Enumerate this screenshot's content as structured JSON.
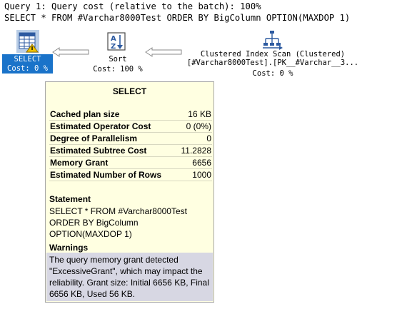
{
  "query": {
    "line1": "Query 1: Query cost (relative to the batch): 100%",
    "line2": "SELECT * FROM #Varchar8000Test ORDER BY BigColumn OPTION(MAXDOP 1)"
  },
  "nodes": {
    "select": {
      "label": "SELECT",
      "cost": "Cost: 0 %",
      "icon": "select-icon"
    },
    "sort": {
      "label": "Sort",
      "cost": "Cost: 100 %",
      "icon": "sort-icon"
    },
    "scan": {
      "label": "Clustered Index Scan (Clustered)",
      "object": "[#Varchar8000Test].[PK__#Varchar__3...",
      "cost": "Cost: 0 %",
      "icon": "clustered-index-scan-icon"
    }
  },
  "tooltip": {
    "title": "SELECT",
    "rows": [
      {
        "key": "Cached plan size",
        "value": "16 KB"
      },
      {
        "key": "Estimated Operator Cost",
        "value": "0 (0%)"
      },
      {
        "key": "Degree of Parallelism",
        "value": "0"
      },
      {
        "key": "Estimated Subtree Cost",
        "value": "11.2828"
      },
      {
        "key": "Memory Grant",
        "value": "6656"
      },
      {
        "key": "Estimated Number of Rows",
        "value": "1000"
      }
    ],
    "statement_heading": "Statement",
    "statement_lines": [
      "SELECT * FROM #Varchar8000Test",
      "ORDER BY BigColumn",
      "OPTION(MAXDOP 1)"
    ],
    "warnings_heading": "Warnings",
    "warnings_text": "The query memory grant detected \"ExcessiveGrant\", which may impact the reliability. Grant size: Initial 6656 KB, Final 6656 KB, Used 56 KB."
  },
  "colors": {
    "selection": "#1a73c9",
    "tooltip_bg": "#ffffe1",
    "warning_bg": "#d7d7e3"
  }
}
